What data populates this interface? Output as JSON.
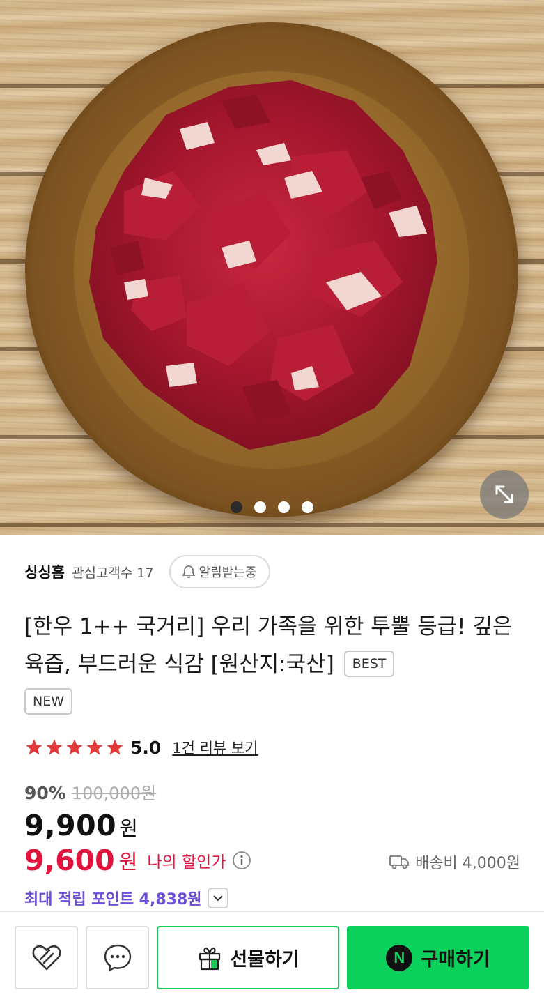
{
  "hero": {
    "image_icon": "meat-on-wooden-plate",
    "expand_icon": "expand-arrows-icon",
    "carousel": {
      "count": 4,
      "active_index": 0
    }
  },
  "store": {
    "name": "싱싱홈",
    "follower_text": "관심고객수 17",
    "alarm_label": "알림받는중"
  },
  "product": {
    "title": "[한우 1++ 국거리] 우리 가족을 위한 투뿔 등급! 깊은 육즙, 부드러운 식감 [원산지:국산]",
    "badges": [
      "BEST",
      "NEW"
    ]
  },
  "rating": {
    "stars": 5,
    "score": "5.0",
    "review_link": "1건 리뷰 보기"
  },
  "price": {
    "discount_rate": "90%",
    "original_price": "100,000원",
    "sale_price": "9,900",
    "sale_unit": "원",
    "member_price": "9,600",
    "member_unit": "원",
    "member_label": "나의 할인가",
    "shipping": "배송비 4,000원",
    "points": "최대 적립 포인트 4,838원"
  },
  "bottom_bar": {
    "gift_label": "선물하기",
    "buy_label": "구매하기",
    "npay_letter": "N"
  },
  "colors": {
    "accent_red": "#e0143c",
    "points_purple": "#6c4fd6",
    "buy_green": "#0bd15c",
    "gift_border_green": "#1ec85a",
    "star_red": "#e23a3a"
  }
}
